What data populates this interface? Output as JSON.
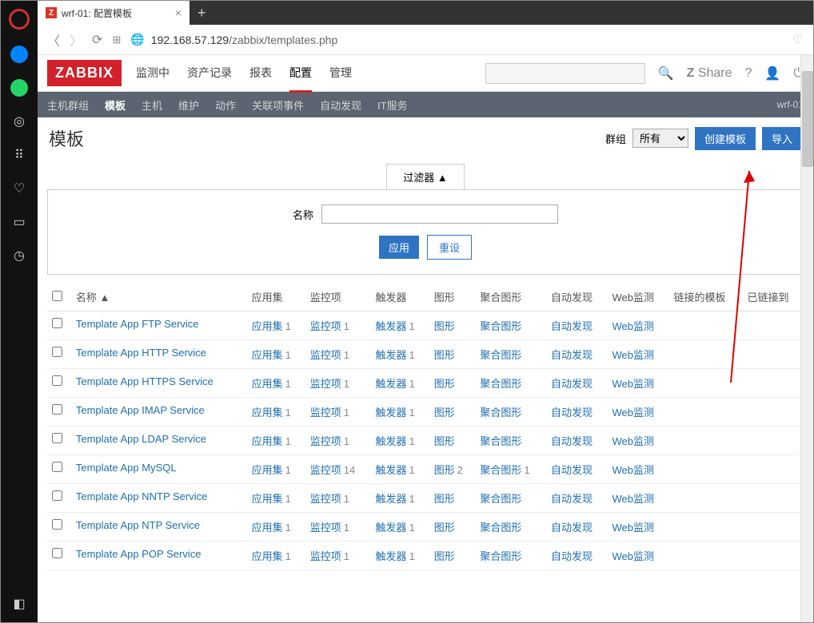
{
  "window": {
    "title": "wrf-01: 配置模板"
  },
  "url": {
    "host": "192.168.57.129",
    "path": "/zabbix/templates.php"
  },
  "zabbix": {
    "logo": "ZABBIX",
    "menu": [
      "监测中",
      "资产记录",
      "报表",
      "配置",
      "管理"
    ],
    "menu_active": "配置",
    "submenu": [
      "主机群组",
      "模板",
      "主机",
      "维护",
      "动作",
      "关联项事件",
      "自动发现",
      "IT服务"
    ],
    "submenu_active": "模板",
    "server": "wrf-01",
    "share": "Share",
    "page_title": "模板",
    "group_label": "群组",
    "group_value": "所有",
    "create_btn": "创建模板",
    "import_btn": "导入",
    "filter_tab": "过滤器 ▲",
    "filter_name_label": "名称",
    "apply_btn": "应用",
    "reset_btn": "重设",
    "columns": [
      "名称 ▲",
      "应用集",
      "监控项",
      "触发器",
      "图形",
      "聚合图形",
      "自动发现",
      "Web监测",
      "链接的模板",
      "已链接到"
    ],
    "rows": [
      {
        "name": "Template App FTP Service",
        "app": "应用集",
        "app_n": "1",
        "item": "监控项",
        "item_n": "1",
        "trig": "触发器",
        "trig_n": "1",
        "graph": "图形",
        "scr": "聚合图形",
        "disc": "自动发现",
        "web": "Web监测"
      },
      {
        "name": "Template App HTTP Service",
        "app": "应用集",
        "app_n": "1",
        "item": "监控项",
        "item_n": "1",
        "trig": "触发器",
        "trig_n": "1",
        "graph": "图形",
        "scr": "聚合图形",
        "disc": "自动发现",
        "web": "Web监测"
      },
      {
        "name": "Template App HTTPS Service",
        "app": "应用集",
        "app_n": "1",
        "item": "监控项",
        "item_n": "1",
        "trig": "触发器",
        "trig_n": "1",
        "graph": "图形",
        "scr": "聚合图形",
        "disc": "自动发现",
        "web": "Web监测"
      },
      {
        "name": "Template App IMAP Service",
        "app": "应用集",
        "app_n": "1",
        "item": "监控项",
        "item_n": "1",
        "trig": "触发器",
        "trig_n": "1",
        "graph": "图形",
        "scr": "聚合图形",
        "disc": "自动发现",
        "web": "Web监测"
      },
      {
        "name": "Template App LDAP Service",
        "app": "应用集",
        "app_n": "1",
        "item": "监控项",
        "item_n": "1",
        "trig": "触发器",
        "trig_n": "1",
        "graph": "图形",
        "scr": "聚合图形",
        "disc": "自动发现",
        "web": "Web监测"
      },
      {
        "name": "Template App MySQL",
        "app": "应用集",
        "app_n": "1",
        "item": "监控项",
        "item_n": "14",
        "trig": "触发器",
        "trig_n": "1",
        "graph": "图形",
        "graph_n": "2",
        "scr": "聚合图形",
        "scr_n": "1",
        "disc": "自动发现",
        "web": "Web监测"
      },
      {
        "name": "Template App NNTP Service",
        "app": "应用集",
        "app_n": "1",
        "item": "监控项",
        "item_n": "1",
        "trig": "触发器",
        "trig_n": "1",
        "graph": "图形",
        "scr": "聚合图形",
        "disc": "自动发现",
        "web": "Web监测"
      },
      {
        "name": "Template App NTP Service",
        "app": "应用集",
        "app_n": "1",
        "item": "监控项",
        "item_n": "1",
        "trig": "触发器",
        "trig_n": "1",
        "graph": "图形",
        "scr": "聚合图形",
        "disc": "自动发现",
        "web": "Web监测"
      },
      {
        "name": "Template App POP Service",
        "app": "应用集",
        "app_n": "1",
        "item": "监控项",
        "item_n": "1",
        "trig": "触发器",
        "trig_n": "1",
        "graph": "图形",
        "scr": "聚合图形",
        "disc": "自动发现",
        "web": "Web监测"
      }
    ]
  }
}
